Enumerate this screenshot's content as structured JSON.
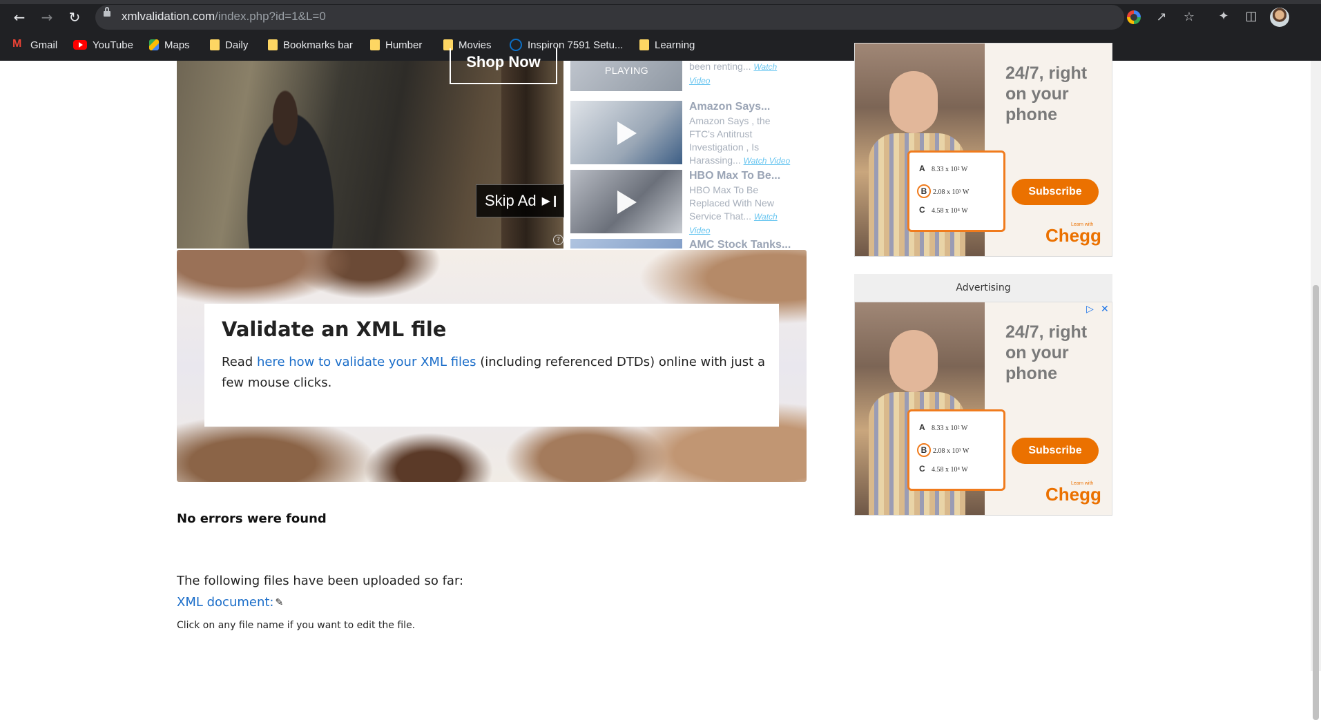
{
  "browser": {
    "url_host": "xmlvalidation.com",
    "url_path": "/index.php?id=1&L=0",
    "bookmarks": [
      {
        "label": "Gmail",
        "icon": "gmail-icon"
      },
      {
        "label": "YouTube",
        "icon": "youtube-icon"
      },
      {
        "label": "Maps",
        "icon": "maps-icon"
      },
      {
        "label": "Daily",
        "icon": "folder-icon"
      },
      {
        "label": "Bookmarks bar",
        "icon": "folder-icon"
      },
      {
        "label": "Humber",
        "icon": "folder-icon"
      },
      {
        "label": "Movies",
        "icon": "folder-icon"
      },
      {
        "label": "Inspiron 7591 Setu...",
        "icon": "dell-icon"
      },
      {
        "label": "Learning",
        "icon": "folder-icon"
      }
    ]
  },
  "video_ad": {
    "shop_now": "Shop Now",
    "skip_ad": "Skip Ad",
    "help": "?"
  },
  "video_list": [
    {
      "title": "",
      "playing": "PLAYING",
      "desc": "Bankruptcy Hertz has been renting...",
      "watch": "Watch Video"
    },
    {
      "title": "Amazon Says...",
      "desc": "Amazon Says , the FTC's Antitrust Investigation , Is Harassing...",
      "watch": "Watch Video"
    },
    {
      "title": "HBO Max To Be...",
      "desc": "HBO Max To Be Replaced  With New Service That...",
      "watch": "Watch Video"
    },
    {
      "title": "AMC Stock Tanks...",
      "desc": "",
      "watch": ""
    }
  ],
  "side_ads": {
    "headline": "24/7, right on your phone",
    "quiz": [
      {
        "letter": "A",
        "text": "8.33 x 10² W"
      },
      {
        "letter": "B",
        "text": "2.08 x 10³ W"
      },
      {
        "letter": "C",
        "text": "4.58 x 10⁴ W"
      }
    ],
    "subscribe": "Subscribe",
    "brand": "Chegg",
    "brand_tag": "Learn with",
    "advertising_label": "Advertising"
  },
  "hero": {
    "title": "Validate an XML file",
    "text_before": "Read ",
    "link": "here how to validate your XML files",
    "text_after": " (including referenced DTDs) online with just a few mouse clicks."
  },
  "result": {
    "status": "No errors were found",
    "files_label": "The following files have been uploaded so far:",
    "xml_link": "XML document:",
    "hint": "Click on any file name if you want to edit the file."
  },
  "colors": {
    "link": "#1a6dc9",
    "chegg_orange": "#eb7100",
    "chrome_bg": "#202124"
  }
}
